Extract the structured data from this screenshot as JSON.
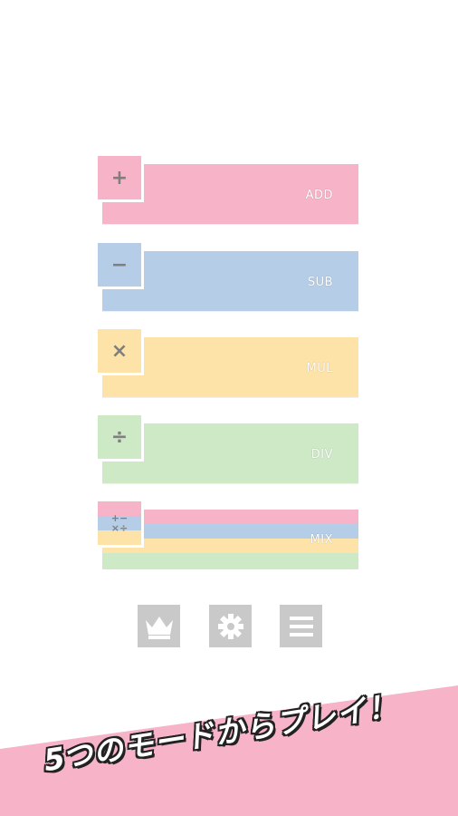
{
  "modes": {
    "add": {
      "symbol": "+",
      "label": "ADD"
    },
    "sub": {
      "symbol": "−",
      "label": "SUB"
    },
    "mul": {
      "symbol": "×",
      "label": "MUL"
    },
    "div": {
      "symbol": "÷",
      "label": "DIV"
    },
    "mix": {
      "symbol_top": "+−",
      "symbol_bottom": "×÷",
      "label": "MIX"
    }
  },
  "toolbar": {
    "ranking_icon": "crown-icon",
    "settings_icon": "gear-icon",
    "menu_icon": "hamburger-menu-icon"
  },
  "colors": {
    "add": "#f7b3c7",
    "sub": "#b5cde6",
    "mul": "#fde3a7",
    "div": "#cde9c6",
    "button": "#c9c9c9",
    "banner": "#f7b3c7"
  },
  "banner": {
    "text": "5つのモードからプレイ！"
  }
}
